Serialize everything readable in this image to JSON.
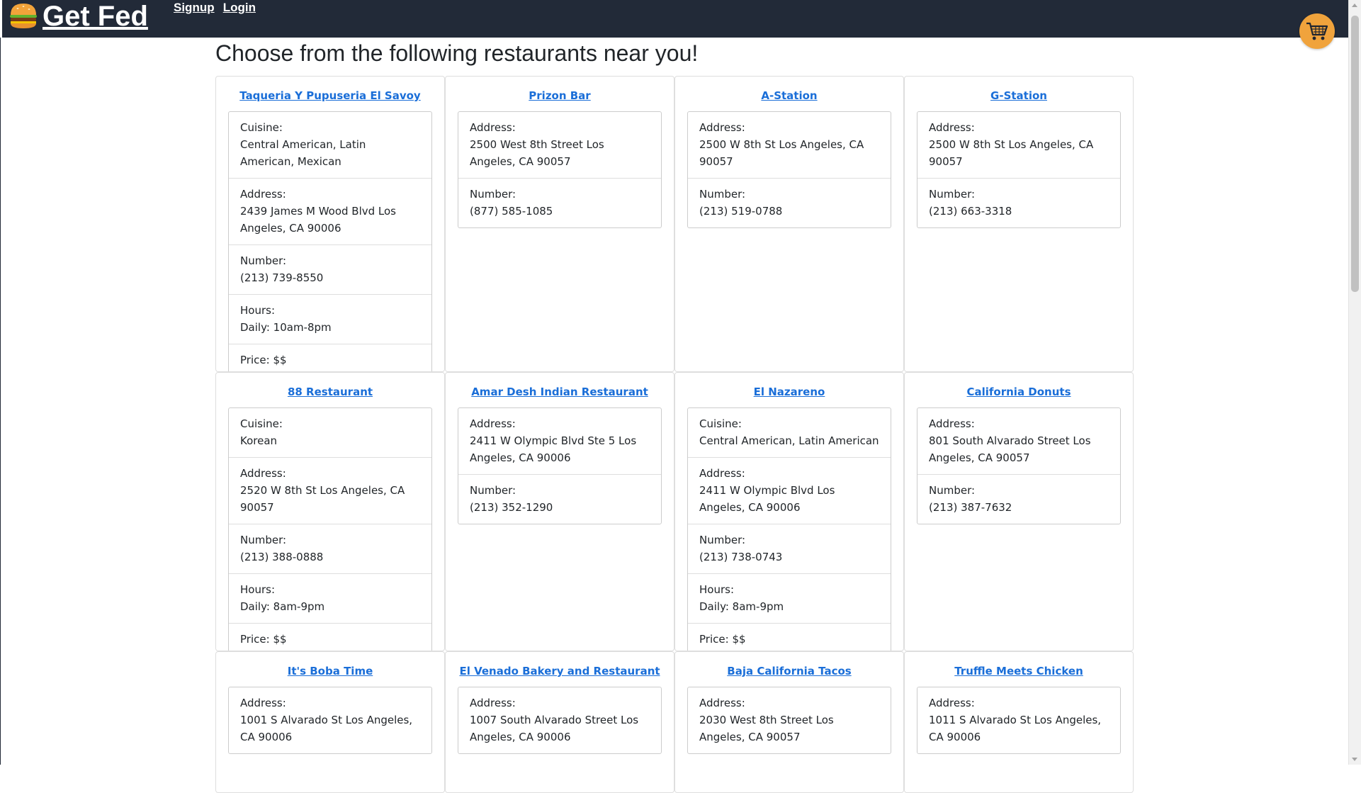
{
  "nav": {
    "brand": "Get Fed",
    "links": [
      "Signup",
      "Login"
    ]
  },
  "page_title": "Choose from the following restaurants near you!",
  "labels": {
    "cuisine": "Cuisine:",
    "address": "Address:",
    "number": "Number:",
    "hours": "Hours:",
    "price": "Price:"
  },
  "colors": {
    "navbar": "#222a38",
    "link": "#1a6ed8",
    "cart": "#f0a33c"
  },
  "icons": {
    "logo": "burger-icon",
    "cart": "shopping-cart-icon"
  },
  "restaurants": [
    {
      "name": "Taqueria Y Pupuseria El Savoy",
      "cuisine": "Central American, Latin American, Mexican",
      "address": "2439 James M Wood Blvd Los Angeles, CA 90006",
      "number": "(213) 739-8550",
      "hours": "Daily: 10am-8pm",
      "price": "$$"
    },
    {
      "name": "Prizon Bar",
      "address": "2500 West 8th Street Los Angeles, CA 90057",
      "number": "(877) 585-1085"
    },
    {
      "name": "A-Station",
      "address": "2500 W 8th St Los Angeles, CA 90057",
      "number": "(213) 519-0788"
    },
    {
      "name": "G-Station",
      "address": "2500 W 8th St Los Angeles, CA 90057",
      "number": "(213) 663-3318"
    },
    {
      "name": "88 Restaurant",
      "cuisine": "Korean",
      "address": "2520 W 8th St Los Angeles, CA 90057",
      "number": "(213) 388-0888",
      "hours": "Daily: 8am-9pm",
      "price": "$$"
    },
    {
      "name": "Amar Desh Indian Restaurant",
      "address": "2411 W Olympic Blvd Ste 5 Los Angeles, CA 90006",
      "number": "(213) 352-1290"
    },
    {
      "name": "El Nazareno",
      "cuisine": "Central American, Latin American",
      "address": "2411 W Olympic Blvd Los Angeles, CA 90006",
      "number": "(213) 738-0743",
      "hours": "Daily: 8am-9pm",
      "price": "$$"
    },
    {
      "name": "California Donuts",
      "address": "801 South Alvarado Street Los Angeles, CA 90057",
      "number": "(213) 387-7632"
    },
    {
      "name": "It's Boba Time",
      "address": "1001 S Alvarado St Los Angeles, CA 90006"
    },
    {
      "name": "El Venado Bakery and Restaurant",
      "address": "1007 South Alvarado Street Los Angeles, CA 90006"
    },
    {
      "name": "Baja California Tacos",
      "address": "2030 West 8th Street Los Angeles, CA 90057"
    },
    {
      "name": "Truffle Meets Chicken",
      "address": "1011 S Alvarado St Los Angeles, CA 90006"
    }
  ]
}
